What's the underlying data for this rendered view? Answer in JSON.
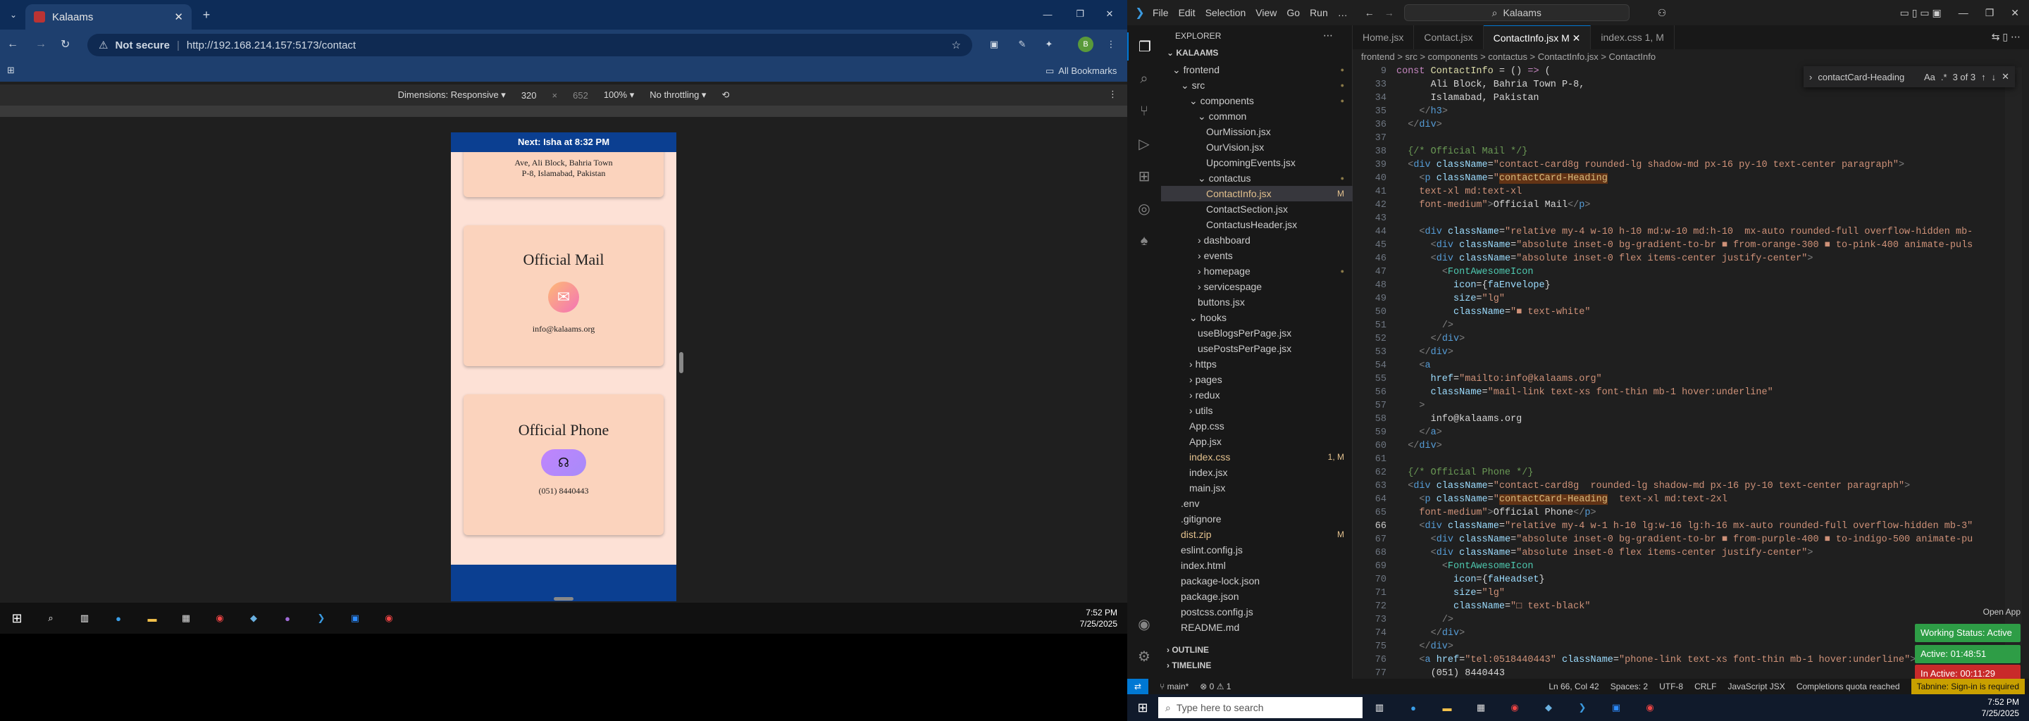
{
  "browser": {
    "tab_title": "Kalaams",
    "url_warning": "Not secure",
    "url": "http://192.168.214.157:5173/contact",
    "bookmarks_label": "All Bookmarks"
  },
  "devtools": {
    "dimensions_label": "Dimensions: Responsive ▾",
    "width": "320",
    "x": "×",
    "height": "652",
    "zoom": "100% ▾",
    "throttle": "No throttling ▾"
  },
  "site": {
    "next_banner_prefix": "Next: ",
    "next_banner_name": "Isha",
    "next_banner_suffix": " at 8:32 PM",
    "address_line1": "Ave, Ali Block, Bahria Town",
    "address_line2": "P-8, Islamabad, Pakistan",
    "mail_heading": "Official Mail",
    "mail_value": "info@kalaams.org",
    "phone_heading": "Official Phone",
    "phone_value": "(051) 8440443"
  },
  "left_taskbar": {
    "time": "7:52 PM",
    "date": "7/25/2025"
  },
  "vscode": {
    "menu": [
      "File",
      "Edit",
      "Selection",
      "View",
      "Go",
      "Run",
      "…"
    ],
    "search": "Kalaams",
    "explorer_title": "EXPLORER",
    "root": "KALAAMS",
    "tree": [
      {
        "label": "frontend",
        "depth": 1,
        "type": "folder-open",
        "badge": "dot"
      },
      {
        "label": "src",
        "depth": 2,
        "type": "folder-open",
        "badge": "dot"
      },
      {
        "label": "components",
        "depth": 3,
        "type": "folder-open",
        "badge": "dot"
      },
      {
        "label": "common",
        "depth": 4,
        "type": "folder-open",
        "badge": ""
      },
      {
        "label": "OurMission.jsx",
        "depth": 5,
        "type": "file",
        "badge": ""
      },
      {
        "label": "OurVision.jsx",
        "depth": 5,
        "type": "file",
        "badge": ""
      },
      {
        "label": "UpcomingEvents.jsx",
        "depth": 5,
        "type": "file",
        "badge": ""
      },
      {
        "label": "contactus",
        "depth": 4,
        "type": "folder-open",
        "badge": "dot"
      },
      {
        "label": "ContactInfo.jsx",
        "depth": 5,
        "type": "file",
        "badge": "M",
        "selected": true
      },
      {
        "label": "ContactSection.jsx",
        "depth": 5,
        "type": "file",
        "badge": ""
      },
      {
        "label": "ContactusHeader.jsx",
        "depth": 5,
        "type": "file",
        "badge": ""
      },
      {
        "label": "dashboard",
        "depth": 4,
        "type": "folder",
        "badge": ""
      },
      {
        "label": "events",
        "depth": 4,
        "type": "folder",
        "badge": ""
      },
      {
        "label": "homepage",
        "depth": 4,
        "type": "folder",
        "badge": "dot"
      },
      {
        "label": "servicespage",
        "depth": 4,
        "type": "folder",
        "badge": ""
      },
      {
        "label": "buttons.jsx",
        "depth": 4,
        "type": "file",
        "badge": ""
      },
      {
        "label": "hooks",
        "depth": 3,
        "type": "folder-open",
        "badge": ""
      },
      {
        "label": "useBlogsPerPage.jsx",
        "depth": 4,
        "type": "file",
        "badge": ""
      },
      {
        "label": "usePostsPerPage.jsx",
        "depth": 4,
        "type": "file",
        "badge": ""
      },
      {
        "label": "https",
        "depth": 3,
        "type": "folder",
        "badge": ""
      },
      {
        "label": "pages",
        "depth": 3,
        "type": "folder",
        "badge": ""
      },
      {
        "label": "redux",
        "depth": 3,
        "type": "folder",
        "badge": ""
      },
      {
        "label": "utils",
        "depth": 3,
        "type": "folder",
        "badge": ""
      },
      {
        "label": "App.css",
        "depth": 3,
        "type": "file",
        "badge": ""
      },
      {
        "label": "App.jsx",
        "depth": 3,
        "type": "file",
        "badge": ""
      },
      {
        "label": "index.css",
        "depth": 3,
        "type": "file",
        "badge": "1, M"
      },
      {
        "label": "index.jsx",
        "depth": 3,
        "type": "file",
        "badge": ""
      },
      {
        "label": "main.jsx",
        "depth": 3,
        "type": "file",
        "badge": ""
      },
      {
        "label": ".env",
        "depth": 2,
        "type": "file",
        "badge": ""
      },
      {
        "label": ".gitignore",
        "depth": 2,
        "type": "file",
        "badge": ""
      },
      {
        "label": "dist.zip",
        "depth": 2,
        "type": "file",
        "badge": "M"
      },
      {
        "label": "eslint.config.js",
        "depth": 2,
        "type": "file",
        "badge": ""
      },
      {
        "label": "index.html",
        "depth": 2,
        "type": "file",
        "badge": ""
      },
      {
        "label": "package-lock.json",
        "depth": 2,
        "type": "file",
        "badge": ""
      },
      {
        "label": "package.json",
        "depth": 2,
        "type": "file",
        "badge": ""
      },
      {
        "label": "postcss.config.js",
        "depth": 2,
        "type": "file",
        "badge": ""
      },
      {
        "label": "README.md",
        "depth": 2,
        "type": "file",
        "badge": ""
      }
    ],
    "outline": "OUTLINE",
    "timeline": "TIMELINE",
    "tabs": [
      {
        "label": "Home.jsx"
      },
      {
        "label": "Contact.jsx"
      },
      {
        "label": "ContactInfo.jsx M",
        "active": true
      },
      {
        "label": "index.css 1, M"
      }
    ],
    "breadcrumb": "frontend > src > components > contactus > ContactInfo.jsx > ContactInfo",
    "find": {
      "query": "contactCard-Heading",
      "result": "3 of 3"
    },
    "status": {
      "branch": "main*",
      "problems": "⊗ 0 ⚠ 1",
      "position": "Ln 66, Col 42",
      "spaces": "Spaces: 2",
      "encoding": "UTF-8",
      "eol": "CRLF",
      "language": "JavaScript JSX",
      "quota": "Completions quota reached",
      "tabnine": "Tabnine: Sign-in is required"
    },
    "overlay": {
      "open_app": "Open App",
      "working": "Working Status: Active",
      "active": "Active: 01:48:51",
      "inactive": "In Active: 00:11:29"
    }
  },
  "right_taskbar": {
    "search": "Type here to search",
    "time": "7:52 PM",
    "date": "7/25/2025"
  },
  "code_lines": [
    {
      "n": "9",
      "html": "<span class=\"k\">const</span> <span class=\"y\">ContactInfo</span> = () <span class=\"k\">=&gt;</span> ("
    },
    {
      "n": "33",
      "html": "      Ali Block, Bahria Town P-8,"
    },
    {
      "n": "34",
      "html": "      Islamabad, Pakistan"
    },
    {
      "n": "35",
      "html": "    <span class=\"p\">&lt;/</span><span class=\"t\">h3</span><span class=\"p\">&gt;</span>"
    },
    {
      "n": "36",
      "html": "  <span class=\"p\">&lt;/</span><span class=\"t\">div</span><span class=\"p\">&gt;</span>"
    },
    {
      "n": "37",
      "html": ""
    },
    {
      "n": "38",
      "html": "  <span class=\"c\">{/* Official Mail */}</span>"
    },
    {
      "n": "39",
      "html": "  <span class=\"p\">&lt;</span><span class=\"t\">div</span> <span class=\"a\">className</span>=<span class=\"s\">\"contact-card8g rounded-lg shadow-md px-16 py-10 text-center paragraph\"</span><span class=\"p\">&gt;</span>"
    },
    {
      "n": "40",
      "html": "    <span class=\"p\">&lt;</span><span class=\"t\">p</span> <span class=\"a\">className</span>=<span class=\"s\">\"<span class=\"hl\">contactCard-Heading</span></span>"
    },
    {
      "n": "41",
      "html": "    <span class=\"s\">text-xl md:text-xl</span>"
    },
    {
      "n": "42",
      "html": "    <span class=\"s\">font-medium\"</span><span class=\"p\">&gt;</span>Official Mail<span class=\"p\">&lt;/</span><span class=\"t\">p</span><span class=\"p\">&gt;</span>"
    },
    {
      "n": "43",
      "html": ""
    },
    {
      "n": "44",
      "html": "    <span class=\"p\">&lt;</span><span class=\"t\">div</span> <span class=\"a\">className</span>=<span class=\"s\">\"relative my-4 w-10 h-10 md:w-10 md:h-10  mx-auto rounded-full overflow-hidden mb-</span>"
    },
    {
      "n": "45",
      "html": "      <span class=\"p\">&lt;</span><span class=\"t\">div</span> <span class=\"a\">className</span>=<span class=\"s\">\"absolute inset-0 bg-gradient-to-br ■ from-orange-300 ■ to-pink-400 animate-puls</span>"
    },
    {
      "n": "46",
      "html": "      <span class=\"p\">&lt;</span><span class=\"t\">div</span> <span class=\"a\">className</span>=<span class=\"s\">\"absolute inset-0 flex items-center justify-center\"</span><span class=\"p\">&gt;</span>"
    },
    {
      "n": "47",
      "html": "        <span class=\"p\">&lt;</span><span class=\"n\">FontAwesomeIcon</span>"
    },
    {
      "n": "48",
      "html": "          <span class=\"a\">icon</span>={<span class=\"a\">faEnvelope</span>}"
    },
    {
      "n": "49",
      "html": "          <span class=\"a\">size</span>=<span class=\"s\">\"lg\"</span>"
    },
    {
      "n": "50",
      "html": "          <span class=\"a\">className</span>=<span class=\"s\">\"■ text-white\"</span>"
    },
    {
      "n": "51",
      "html": "        <span class=\"p\">/&gt;</span>"
    },
    {
      "n": "52",
      "html": "      <span class=\"p\">&lt;/</span><span class=\"t\">div</span><span class=\"p\">&gt;</span>"
    },
    {
      "n": "53",
      "html": "    <span class=\"p\">&lt;/</span><span class=\"t\">div</span><span class=\"p\">&gt;</span>"
    },
    {
      "n": "54",
      "html": "    <span class=\"p\">&lt;</span><span class=\"t\">a</span>"
    },
    {
      "n": "55",
      "html": "      <span class=\"a\">href</span>=<span class=\"s\">\"mailto:info@kalaams.org\"</span>"
    },
    {
      "n": "56",
      "html": "      <span class=\"a\">className</span>=<span class=\"s\">\"mail-link text-xs font-thin mb-1 hover:underline\"</span>"
    },
    {
      "n": "57",
      "html": "    <span class=\"p\">&gt;</span>"
    },
    {
      "n": "58",
      "html": "      info@kalaams.org"
    },
    {
      "n": "59",
      "html": "    <span class=\"p\">&lt;/</span><span class=\"t\">a</span><span class=\"p\">&gt;</span>"
    },
    {
      "n": "60",
      "html": "  <span class=\"p\">&lt;/</span><span class=\"t\">div</span><span class=\"p\">&gt;</span>"
    },
    {
      "n": "61",
      "html": ""
    },
    {
      "n": "62",
      "html": "  <span class=\"c\">{/* Official Phone */}</span>"
    },
    {
      "n": "63",
      "html": "  <span class=\"p\">&lt;</span><span class=\"t\">div</span> <span class=\"a\">className</span>=<span class=\"s\">\"contact-card8g  rounded-lg shadow-md px-16 py-10 text-center paragraph\"</span><span class=\"p\">&gt;</span>"
    },
    {
      "n": "64",
      "html": "    <span class=\"p\">&lt;</span><span class=\"t\">p</span> <span class=\"a\">className</span>=<span class=\"s\">\"<span class=\"hl\">contactCard-Heading</span>  text-xl md:text-2xl</span>"
    },
    {
      "n": "65",
      "html": "    <span class=\"s\">font-medium\"</span><span class=\"p\">&gt;</span>Official Phone<span class=\"p\">&lt;/</span><span class=\"t\">p</span><span class=\"p\">&gt;</span>"
    },
    {
      "n": "66",
      "html": "    <span class=\"p\">&lt;</span><span class=\"t\">div</span> <span class=\"a\">className</span>=<span class=\"s\">\"relative my-4 w-1 h-10 lg:w-16 lg:h-16 mx-auto rounded-full overflow-hidden mb-3\"</span>"
    },
    {
      "n": "67",
      "html": "      <span class=\"p\">&lt;</span><span class=\"t\">div</span> <span class=\"a\">className</span>=<span class=\"s\">\"absolute inset-0 bg-gradient-to-br ■ from-purple-400 ■ to-indigo-500 animate-pu</span>"
    },
    {
      "n": "68",
      "html": "      <span class=\"p\">&lt;</span><span class=\"t\">div</span> <span class=\"a\">className</span>=<span class=\"s\">\"absolute inset-0 flex items-center justify-center\"</span><span class=\"p\">&gt;</span>"
    },
    {
      "n": "69",
      "html": "        <span class=\"p\">&lt;</span><span class=\"n\">FontAwesomeIcon</span>"
    },
    {
      "n": "70",
      "html": "          <span class=\"a\">icon</span>={<span class=\"a\">faHeadset</span>}"
    },
    {
      "n": "71",
      "html": "          <span class=\"a\">size</span>=<span class=\"s\">\"lg\"</span>"
    },
    {
      "n": "72",
      "html": "          <span class=\"a\">className</span>=<span class=\"s\">\"□ text-black\"</span>"
    },
    {
      "n": "73",
      "html": "        <span class=\"p\">/&gt;</span>"
    },
    {
      "n": "74",
      "html": "      <span class=\"p\">&lt;/</span><span class=\"t\">div</span><span class=\"p\">&gt;</span>"
    },
    {
      "n": "75",
      "html": "    <span class=\"p\">&lt;/</span><span class=\"t\">div</span><span class=\"p\">&gt;</span>"
    },
    {
      "n": "76",
      "html": "    <span class=\"p\">&lt;</span><span class=\"t\">a</span> <span class=\"a\">href</span>=<span class=\"s\">\"tel:0518440443\"</span> <span class=\"a\">className</span>=<span class=\"s\">\"phone-link text-xs font-thin mb-1 hover:underline\"</span><span class=\"p\">&gt;</span>"
    },
    {
      "n": "77",
      "html": "      (051) 8440443"
    }
  ]
}
